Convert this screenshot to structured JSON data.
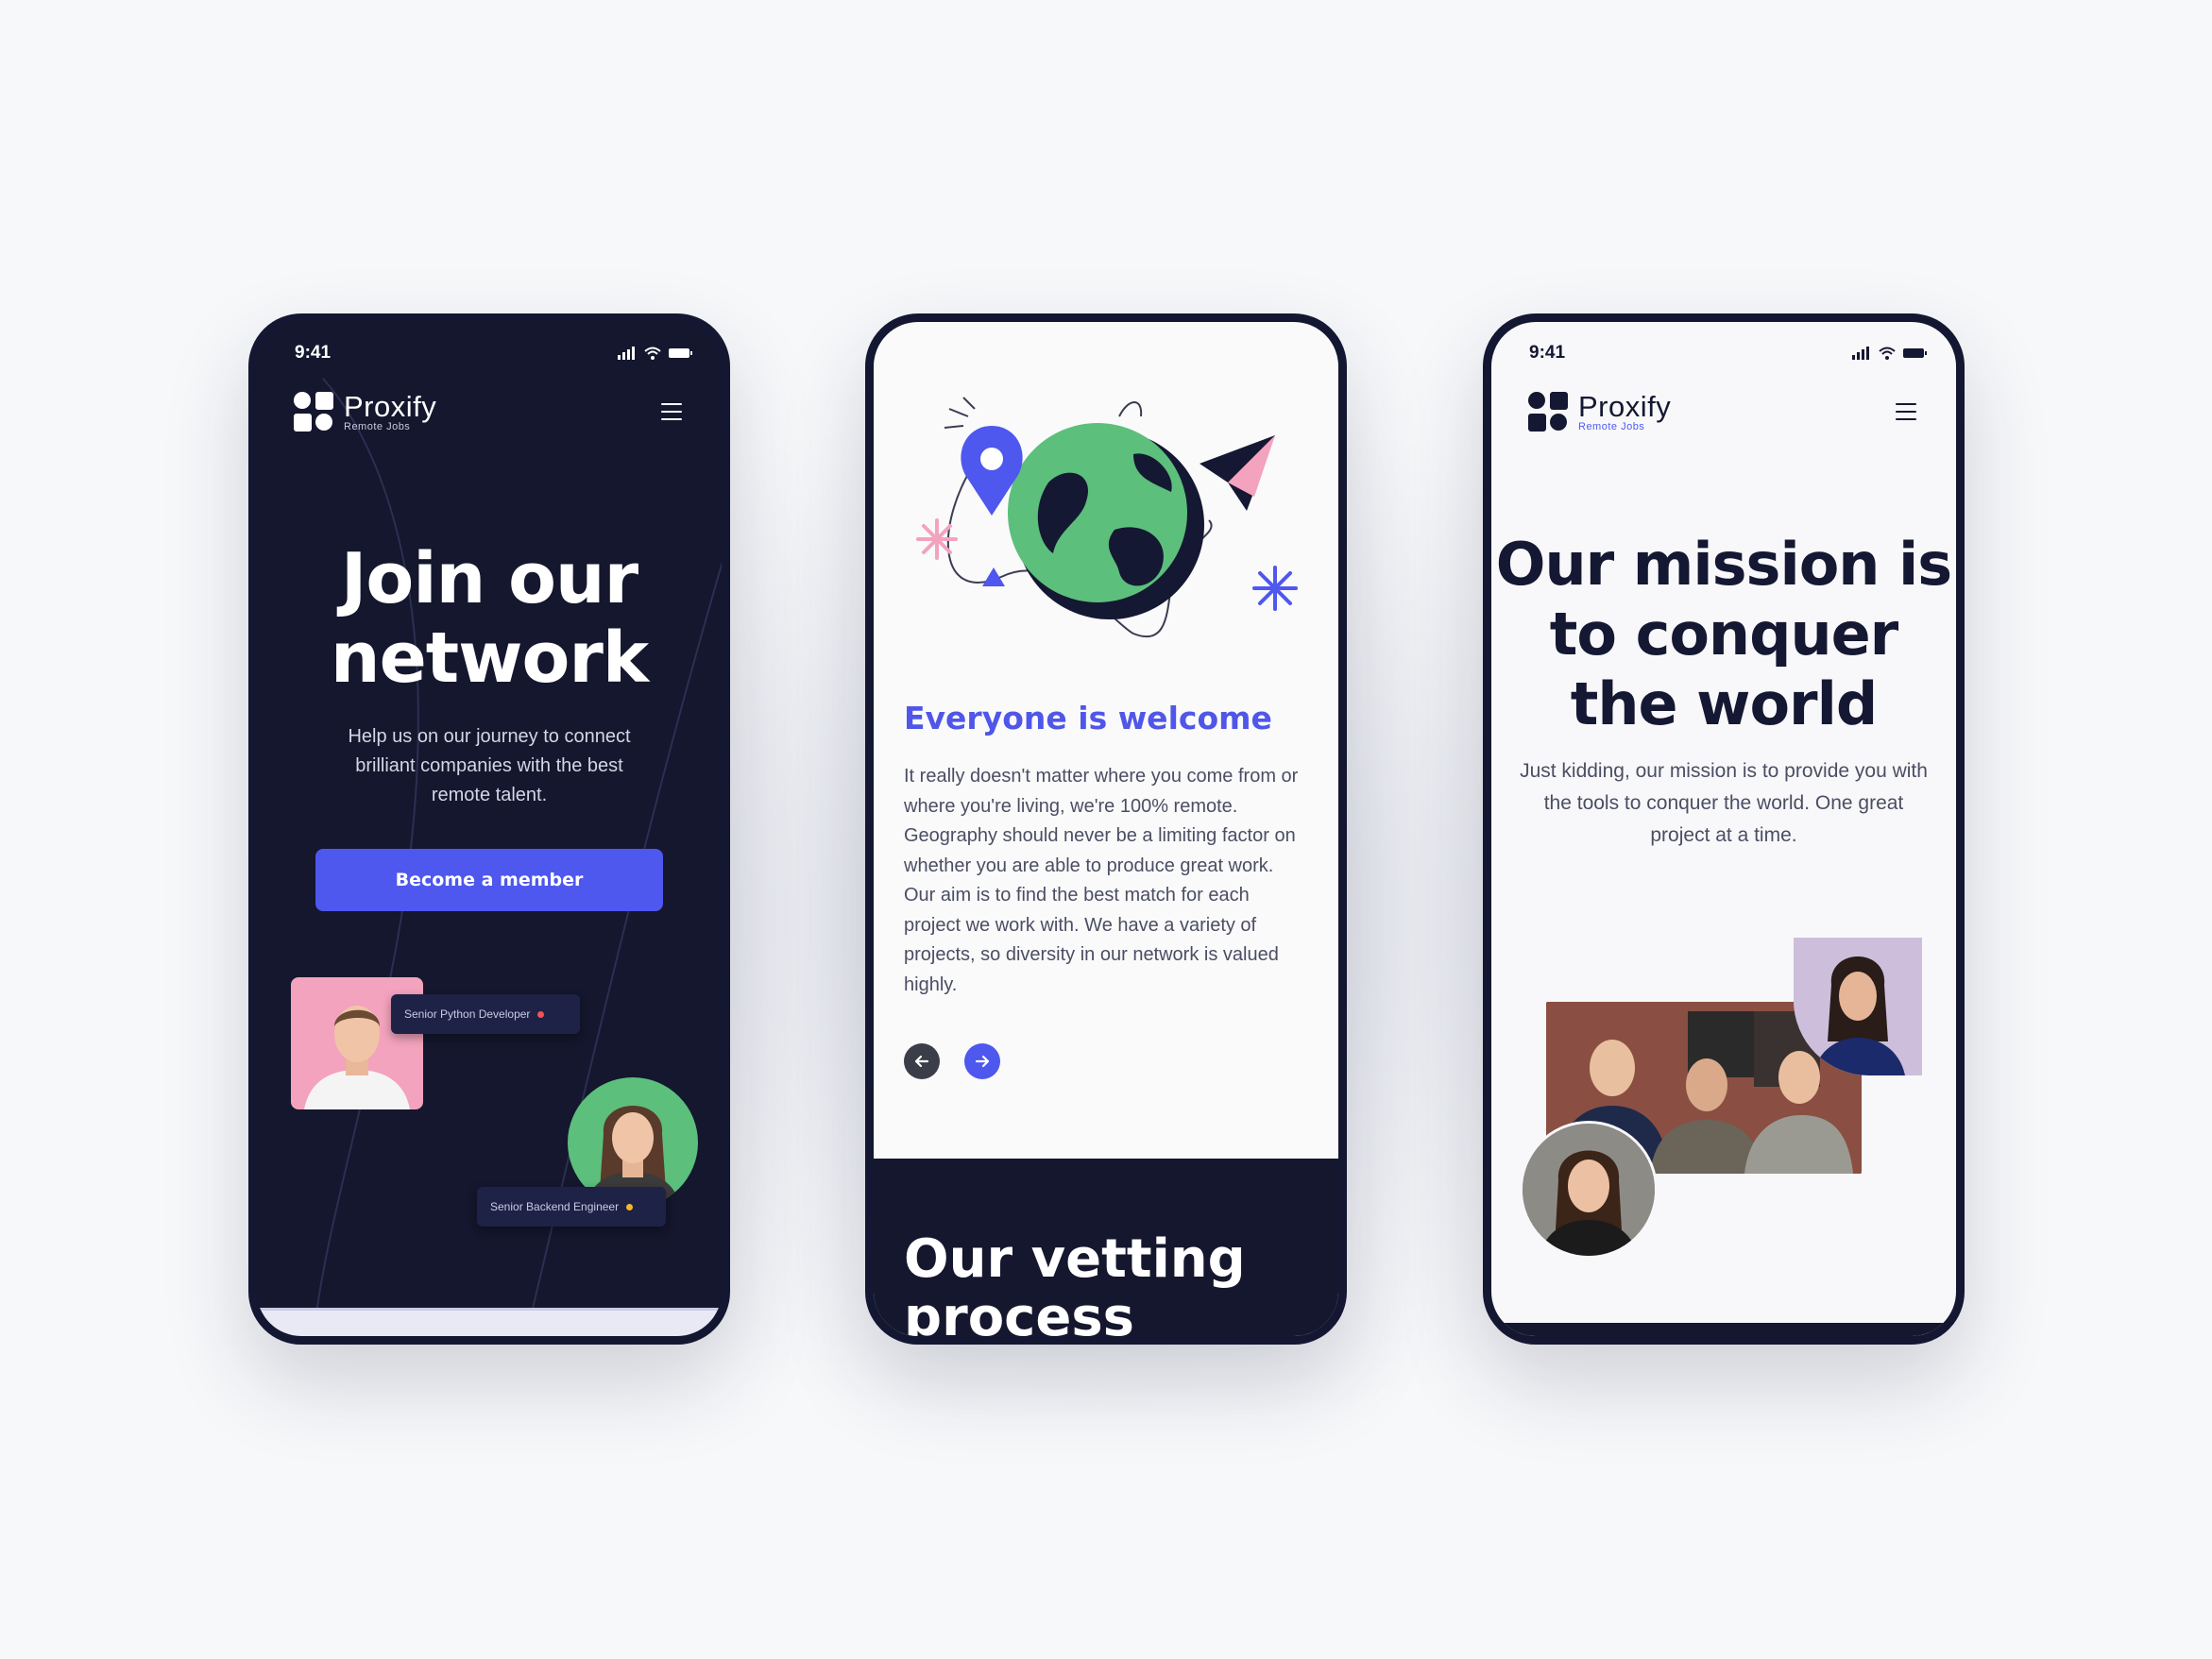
{
  "phones": {
    "left": {
      "status": {
        "time": "9:41"
      },
      "brand": {
        "name": "Proxify",
        "sub": "Remote Jobs"
      },
      "hero": {
        "title": "Join our network",
        "subtitle": "Help us on our journey to connect brilliant companies with the best remote talent."
      },
      "cta_label": "Become a member",
      "tags": [
        {
          "label": "Senior Python Developer",
          "dot_color": "#f05454"
        },
        {
          "label": "Senior Backend Engineer",
          "dot_color": "#f5b52e"
        }
      ]
    },
    "middle": {
      "heading": "Everyone is welcome",
      "body": "It really doesn't matter where you come from or where you're living, we're 100% remote. Geography should never be a limiting factor on whether you are able to produce great work. Our aim is to find the best match for each project we work with. We have a variety of projects, so diversity in our network is valued highly.",
      "vetting_title": "Our vetting process"
    },
    "right": {
      "status": {
        "time": "9:41"
      },
      "brand": {
        "name": "Proxify",
        "sub": "Remote Jobs"
      },
      "hero": {
        "title": "Our mission is to conquer the world",
        "subtitle": "Just kidding, our mission is to provide you with the tools to conquer the world. One great project at a time."
      }
    }
  },
  "colors": {
    "navy": "#14172d",
    "accent": "#4e57ee",
    "green": "#5cbf7c",
    "pink": "#f3a3bd"
  },
  "icons": [
    "signal-icon",
    "wifi-icon",
    "battery-icon",
    "menu-icon",
    "arrow-left-icon",
    "arrow-right-icon",
    "globe-illustration",
    "location-pin-icon",
    "paper-plane-icon",
    "asterisk-icon"
  ]
}
